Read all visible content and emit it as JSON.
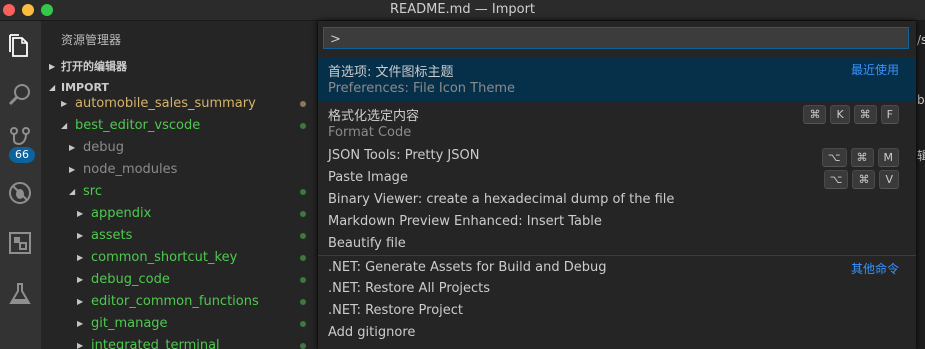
{
  "window": {
    "title": "README.md — Import"
  },
  "activity_bar": {
    "icons": [
      "files-icon",
      "search-icon",
      "source-control-icon",
      "debug-icon",
      "extensions-icon",
      "flask-icon"
    ],
    "scm_badge": "66"
  },
  "sidebar": {
    "title": "资源管理器",
    "open_editors": "打开的编辑器",
    "import_section": "IMPORT",
    "tree": [
      {
        "name": "automobile_sales_summary",
        "color": "#d6b36a",
        "dot": "#8a7a5a"
      },
      {
        "name": "best_editor_vscode",
        "color": "#4ec94e",
        "dot": "#3a7a3a"
      },
      {
        "name": "debug",
        "color": "#8b8b8b",
        "dot": ""
      },
      {
        "name": "node_modules",
        "color": "#8b8b8b",
        "dot": ""
      },
      {
        "name": "src",
        "color": "#4ec94e",
        "dot": "#3a7a3a"
      },
      {
        "name": "appendix",
        "color": "#4ec94e",
        "dot": "#3a7a3a"
      },
      {
        "name": "assets",
        "color": "#4ec94e",
        "dot": "#3a7a3a"
      },
      {
        "name": "common_shortcut_key",
        "color": "#4ec94e",
        "dot": "#3a7a3a"
      },
      {
        "name": "debug_code",
        "color": "#4ec94e",
        "dot": "#3a7a3a"
      },
      {
        "name": "editor_common_functions",
        "color": "#4ec94e",
        "dot": "#3a7a3a"
      },
      {
        "name": "git_manage",
        "color": "#4ec94e",
        "dot": "#3a7a3a"
      },
      {
        "name": "integrated_terminal",
        "color": "#4ec94e",
        "dot": "#3a7a3a"
      }
    ]
  },
  "palette": {
    "input_value": ">",
    "recently_used": "最近使用",
    "other_commands": "其他命令",
    "items": [
      {
        "label": "首选项: 文件图标主题",
        "detail": "Preferences: File Icon Theme"
      },
      {
        "label": "格式化选定内容",
        "detail": "Format Code",
        "keys": [
          "⌘",
          "K",
          "⌘",
          "F"
        ]
      },
      {
        "label": "JSON Tools: Pretty JSON",
        "keys": [
          "⌥",
          "⌘",
          "M"
        ]
      },
      {
        "label": "Paste Image",
        "keys": [
          "⌥",
          "⌘",
          "V"
        ]
      },
      {
        "label": "Binary Viewer: create a hexadecimal dump of the file"
      },
      {
        "label": "Markdown Preview Enhanced: Insert Table"
      },
      {
        "label": "Beautify file"
      },
      {
        "label": ".NET: Generate Assets for Build and Debug"
      },
      {
        "label": ".NET: Restore All Projects"
      },
      {
        "label": ".NET: Restore Project"
      },
      {
        "label": "Add gitignore"
      }
    ]
  },
  "editor_fragments": [
    "/s",
    "b",
    "辑"
  ]
}
